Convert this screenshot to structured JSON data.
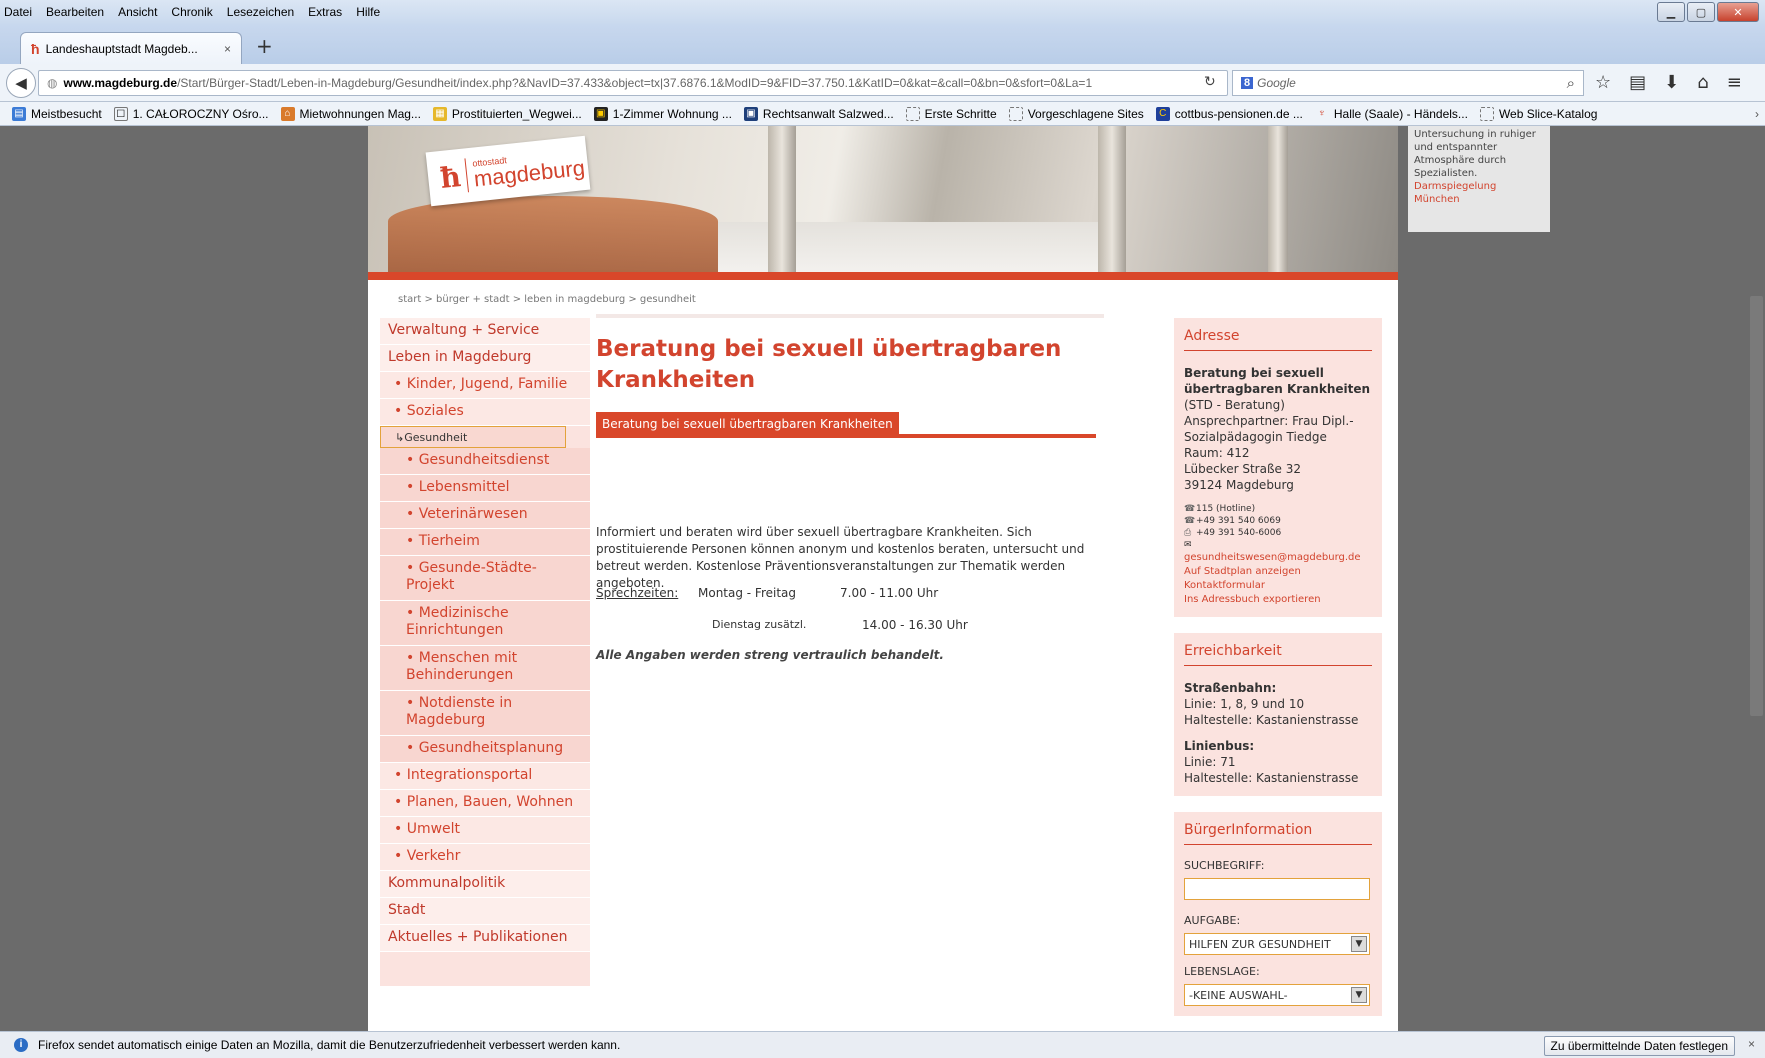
{
  "browser": {
    "menu": [
      "Datei",
      "Bearbeiten",
      "Ansicht",
      "Chronik",
      "Lesezeichen",
      "Extras",
      "Hilfe"
    ],
    "tab_title": "Landeshauptstadt Magdeb...",
    "tab_close": "×",
    "new_tab": "+",
    "url_domain": "www.magdeburg.de",
    "url_path": "/Start/Bürger-Stadt/Leben-in-Magdeburg/Gesundheit/index.php?&NavID=37.433&object=tx|37.6876.1&ModID=9&FID=37.750.1&KatID=0&kat=&call=0&bn=0&sfort=0&La=1",
    "search_placeholder": "Google",
    "bookmarks": [
      {
        "label": "Meistbesucht"
      },
      {
        "label": "1. CAŁOROCZNY Ośro..."
      },
      {
        "label": "Mietwohnungen Mag..."
      },
      {
        "label": "Prostituierten_Wegwei..."
      },
      {
        "label": "1-Zimmer Wohnung ..."
      },
      {
        "label": "Rechtsanwalt Salzwed..."
      },
      {
        "label": "Erste Schritte"
      },
      {
        "label": "Vorgeschlagene Sites"
      },
      {
        "label": "cottbus-pensionen.de ..."
      },
      {
        "label": "Halle (Saale) - Händels..."
      },
      {
        "label": "Web Slice-Katalog"
      }
    ],
    "notification": "Firefox sendet automatisch einige Daten an Mozilla, damit die Benutzerzufriedenheit verbessert werden kann.",
    "notification_button": "Zu übermittelnde Daten festlegen",
    "notification_close": "×"
  },
  "header": {
    "logo_small": "ottostadt",
    "logo_big": "magdeburg"
  },
  "breadcrumb": "start > bürger + stadt > leben in magdeburg > gesundheit",
  "leftnav": [
    {
      "label": "Verwaltung + Service",
      "level": 0
    },
    {
      "label": "Leben in Magdeburg",
      "level": 0
    },
    {
      "label": "• Kinder, Jugend, Familie",
      "level": 1
    },
    {
      "label": "• Soziales",
      "level": 1
    },
    {
      "label": "↳Gesundheit",
      "level": 1
    },
    {
      "label": "• Gesundheitsdienst",
      "level": 2
    },
    {
      "label": "• Lebensmittel",
      "level": 2
    },
    {
      "label": "• Veterinärwesen",
      "level": 2
    },
    {
      "label": "• Tierheim",
      "level": 2
    },
    {
      "label": "• Gesunde-Städte-Projekt",
      "level": 2,
      "tall": true
    },
    {
      "label": "• Medizinische Einrichtungen",
      "level": 2,
      "tall": true
    },
    {
      "label": "• Menschen mit Behinderungen",
      "level": 2,
      "tall": true
    },
    {
      "label": "• Notdienste in Magdeburg",
      "level": 2,
      "tall": true
    },
    {
      "label": "• Gesundheitsplanung",
      "level": 2
    },
    {
      "label": "• Integrationsportal",
      "level": 1
    },
    {
      "label": "• Planen, Bauen, Wohnen",
      "level": 1
    },
    {
      "label": "• Umwelt",
      "level": 1
    },
    {
      "label": "• Verkehr",
      "level": 1
    },
    {
      "label": "Kommunalpolitik",
      "level": 0
    },
    {
      "label": "Stadt",
      "level": 0
    },
    {
      "label": "Aktuelles + Publikationen",
      "level": 0
    }
  ],
  "content": {
    "title": "Beratung bei sexuell übertragbaren Krankheiten",
    "subtab": "Beratung bei sexuell übertragbaren Krankheiten",
    "description": "Informiert und beraten wird über sexuell übertragbare Krankheiten. Sich prostituierende Personen können anonym und kostenlos beraten, untersucht und betreut werden. Kostenlose Präventionsveranstaltungen zur Thematik werden angeboten.",
    "hours_label": "Sprechzeiten:",
    "hours_day1": "Montag - Freitag",
    "hours_time1": "7.00 - 11.00 Uhr",
    "hours_day2": "Dienstag zusätzl.",
    "hours_time2": "14.00 - 16.30 Uhr",
    "note": "Alle Angaben werden streng vertraulich behandelt."
  },
  "address": {
    "heading": "Adresse",
    "name": "Beratung bei sexuell übertragbaren Krankheiten",
    "lines": [
      "(STD - Beratung)",
      "Ansprechpartner: Frau Dipl.-Sozialpädagogin Tiedge",
      "Raum: 412",
      "Lübecker Straße 32",
      "39124 Magdeburg"
    ],
    "phone1": "115 (Hotline)",
    "phone2": "+49 391 540 6069",
    "fax": "+49 391 540-6006",
    "email": "gesundheitswesen@magdeburg.de",
    "links": [
      "Auf Stadtplan anzeigen",
      "Kontaktformular",
      "Ins Adressbuch exportieren"
    ]
  },
  "reach": {
    "heading": "Erreichbarkeit",
    "tram_label": "Straßenbahn:",
    "tram_line": "Linie: 1, 8, 9 und 10",
    "tram_stop": "Haltestelle: Kastanienstrasse",
    "bus_label": "Linienbus:",
    "bus_line": "Linie: 71",
    "bus_stop": "Haltestelle: Kastanienstrasse"
  },
  "citizen": {
    "heading": "BürgerInformation",
    "search_label": "SUCHBEGRIFF:",
    "task_label": "AUFGABE:",
    "task_value": "HILFEN ZUR GESUNDHEIT",
    "life_label": "LEBENSLAGE:",
    "life_value": "-KEINE AUSWAHL-"
  },
  "ad": {
    "lines": [
      "Untersuchung in ruhiger",
      "und entspannter",
      "Atmosphäre durch",
      "Spezialisten."
    ],
    "link": "Darmspiegelung München"
  }
}
